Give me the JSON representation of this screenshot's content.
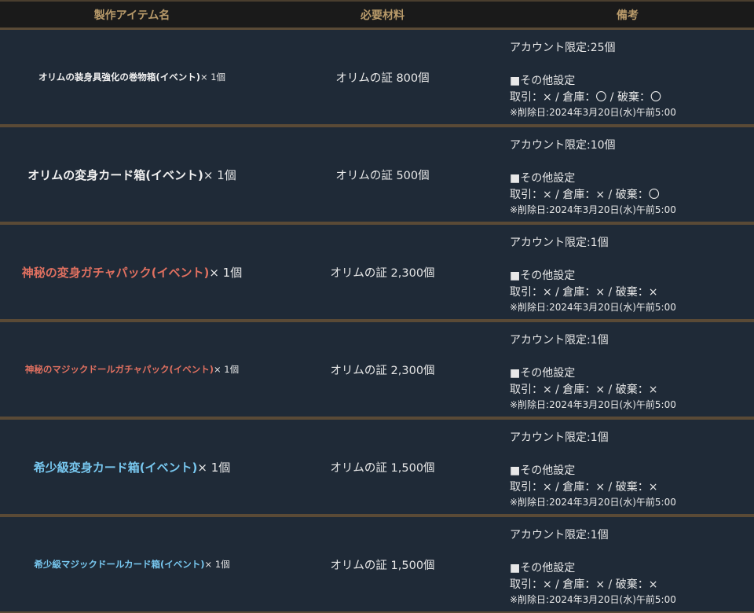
{
  "header": {
    "col1": "製作アイテム名",
    "col2": "必要材料",
    "col3": "備考"
  },
  "rows": [
    {
      "item": "オリムの装身具強化の巻物箱(イベント)",
      "qty": " × 1個",
      "color": "#f0f0f0",
      "material": "オリムの証 800個",
      "limit": "アカウント限定:25個",
      "settings": "■その他設定",
      "trade": "取引：× / 倉庫：〇 / 破棄：〇",
      "delete": "※削除日:2024年3月20日(水)午前5:00"
    },
    {
      "item": "オリムの変身カード箱(イベント)",
      "qty": " × 1個",
      "color": "#f0f0f0",
      "material": "オリムの証 500個",
      "limit": "アカウント限定:10個",
      "settings": "■その他設定",
      "trade": "取引：× / 倉庫：× / 破棄：〇",
      "delete": "※削除日:2024年3月20日(水)午前5:00"
    },
    {
      "item": "神秘の変身ガチャパック(イベント)",
      "qty": " × 1個",
      "color": "#e07060",
      "material": "オリムの証 2,300個",
      "limit": "アカウント限定:1個",
      "settings": "■その他設定",
      "trade": "取引：× / 倉庫：× / 破棄：×",
      "delete": "※削除日:2024年3月20日(水)午前5:00"
    },
    {
      "item": "神秘のマジックドールガチャパック(イベント)",
      "qty": " × 1個",
      "color": "#e07060",
      "material": "オリムの証 2,300個",
      "limit": "アカウント限定:1個",
      "settings": "■その他設定",
      "trade": "取引：× / 倉庫：× / 破棄：×",
      "delete": "※削除日:2024年3月20日(水)午前5:00"
    },
    {
      "item": "希少級変身カード箱(イベント)",
      "qty": " × 1個",
      "color": "#78c8f0",
      "material": "オリムの証 1,500個",
      "limit": "アカウント限定:1個",
      "settings": "■その他設定",
      "trade": "取引：× / 倉庫：× / 破棄：×",
      "delete": "※削除日:2024年3月20日(水)午前5:00"
    },
    {
      "item": "希少級マジックドールカード箱(イベント)",
      "qty": " × 1個",
      "color": "#78c8f0",
      "material": "オリムの証 1,500個",
      "limit": "アカウント限定:1個",
      "settings": "■その他設定",
      "trade": "取引：× / 倉庫：× / 破棄：×",
      "delete": "※削除日:2024年3月20日(水)午前5:00"
    }
  ]
}
